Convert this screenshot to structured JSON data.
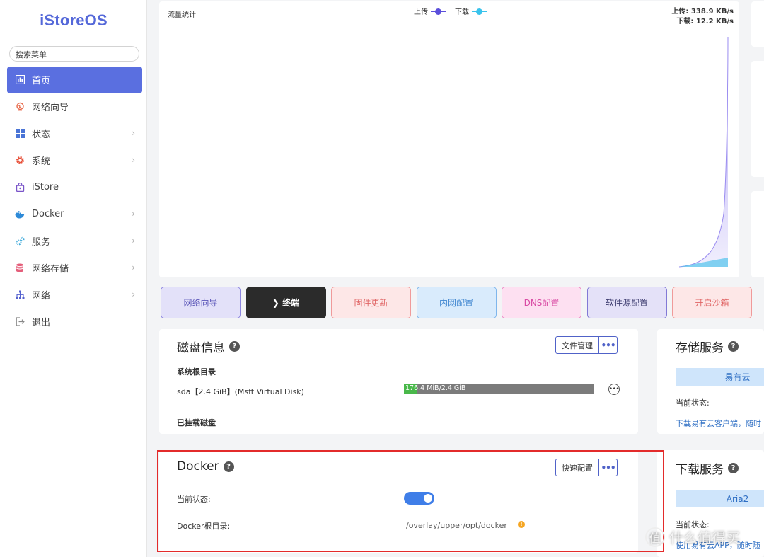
{
  "sidebar": {
    "logo": "iStoreOS",
    "search_placeholder": "搜索菜单",
    "items": [
      {
        "label": "首页",
        "icon": "dashboard-icon",
        "active": true,
        "chevron": false
      },
      {
        "label": "网络向导",
        "icon": "globe-icon",
        "chevron": false
      },
      {
        "label": "状态",
        "icon": "grid-icon",
        "chevron": true
      },
      {
        "label": "系统",
        "icon": "gear-icon",
        "chevron": true
      },
      {
        "label": "iStore",
        "icon": "store-bag-icon",
        "chevron": false
      },
      {
        "label": "Docker",
        "icon": "docker-whale-icon",
        "chevron": true
      },
      {
        "label": "服务",
        "icon": "cogs-icon",
        "chevron": true
      },
      {
        "label": "网络存储",
        "icon": "database-icon",
        "chevron": true
      },
      {
        "label": "网络",
        "icon": "network-tree-icon",
        "chevron": true
      },
      {
        "label": "退出",
        "icon": "logout-icon",
        "chevron": false
      }
    ]
  },
  "traffic": {
    "title": "流量统计",
    "legend_upload": "上传",
    "legend_download": "下载",
    "upload_rate": "上传: 338.9 KB/s",
    "download_rate": "下载: 12.2 KB/s"
  },
  "quick_buttons": [
    {
      "label": "网络向导",
      "bg": "#e3e1f9",
      "border": "#8d86e0",
      "color": "#5a55b8"
    },
    {
      "label": "❯ 终端",
      "bg": "#2b2b2b",
      "border": "#2b2b2b",
      "color": "#ffffff"
    },
    {
      "label": "固件更新",
      "bg": "#fde7e7",
      "border": "#f09a9a",
      "color": "#e06565"
    },
    {
      "label": "内网配置",
      "bg": "#d9ebfc",
      "border": "#7fb6ec",
      "color": "#3f86d0"
    },
    {
      "label": "DNS配置",
      "bg": "#fde0f1",
      "border": "#ec8cc6",
      "color": "#d94aa4"
    },
    {
      "label": "软件源配置",
      "bg": "#e4e1f8",
      "border": "#8279d6",
      "color": "#3b3a6e"
    },
    {
      "label": "开启沙箱",
      "bg": "#fde7e7",
      "border": "#f09a9a",
      "color": "#e06565"
    }
  ],
  "disk": {
    "title": "磁盘信息",
    "file_mgr": "文件管理",
    "root_label": "系统根目录",
    "disk_name": "sda【2.4 GiB】(Msft Virtual Disk)",
    "usage_text": "176.4 MiB/2.4 GiB",
    "usage_fraction": 0.072,
    "mounted_label": "已挂载磁盘"
  },
  "storage_service": {
    "title": "存储服务",
    "bar_label": "易有云",
    "status_label": "当前状态:",
    "link": "下载易有云客户端，随时"
  },
  "docker": {
    "title": "Docker",
    "quick_config": "快速配置",
    "status_label": "当前状态:",
    "root_label": "Docker根目录:",
    "root_path": "/overlay/upper/opt/docker",
    "enabled": true
  },
  "download_service": {
    "title": "下载服务",
    "bar_label": "Aria2",
    "status_label": "当前状态:",
    "link": "使用易有云APP，随时随"
  },
  "watermark": {
    "badge": "值",
    "text": "什么值得买"
  }
}
